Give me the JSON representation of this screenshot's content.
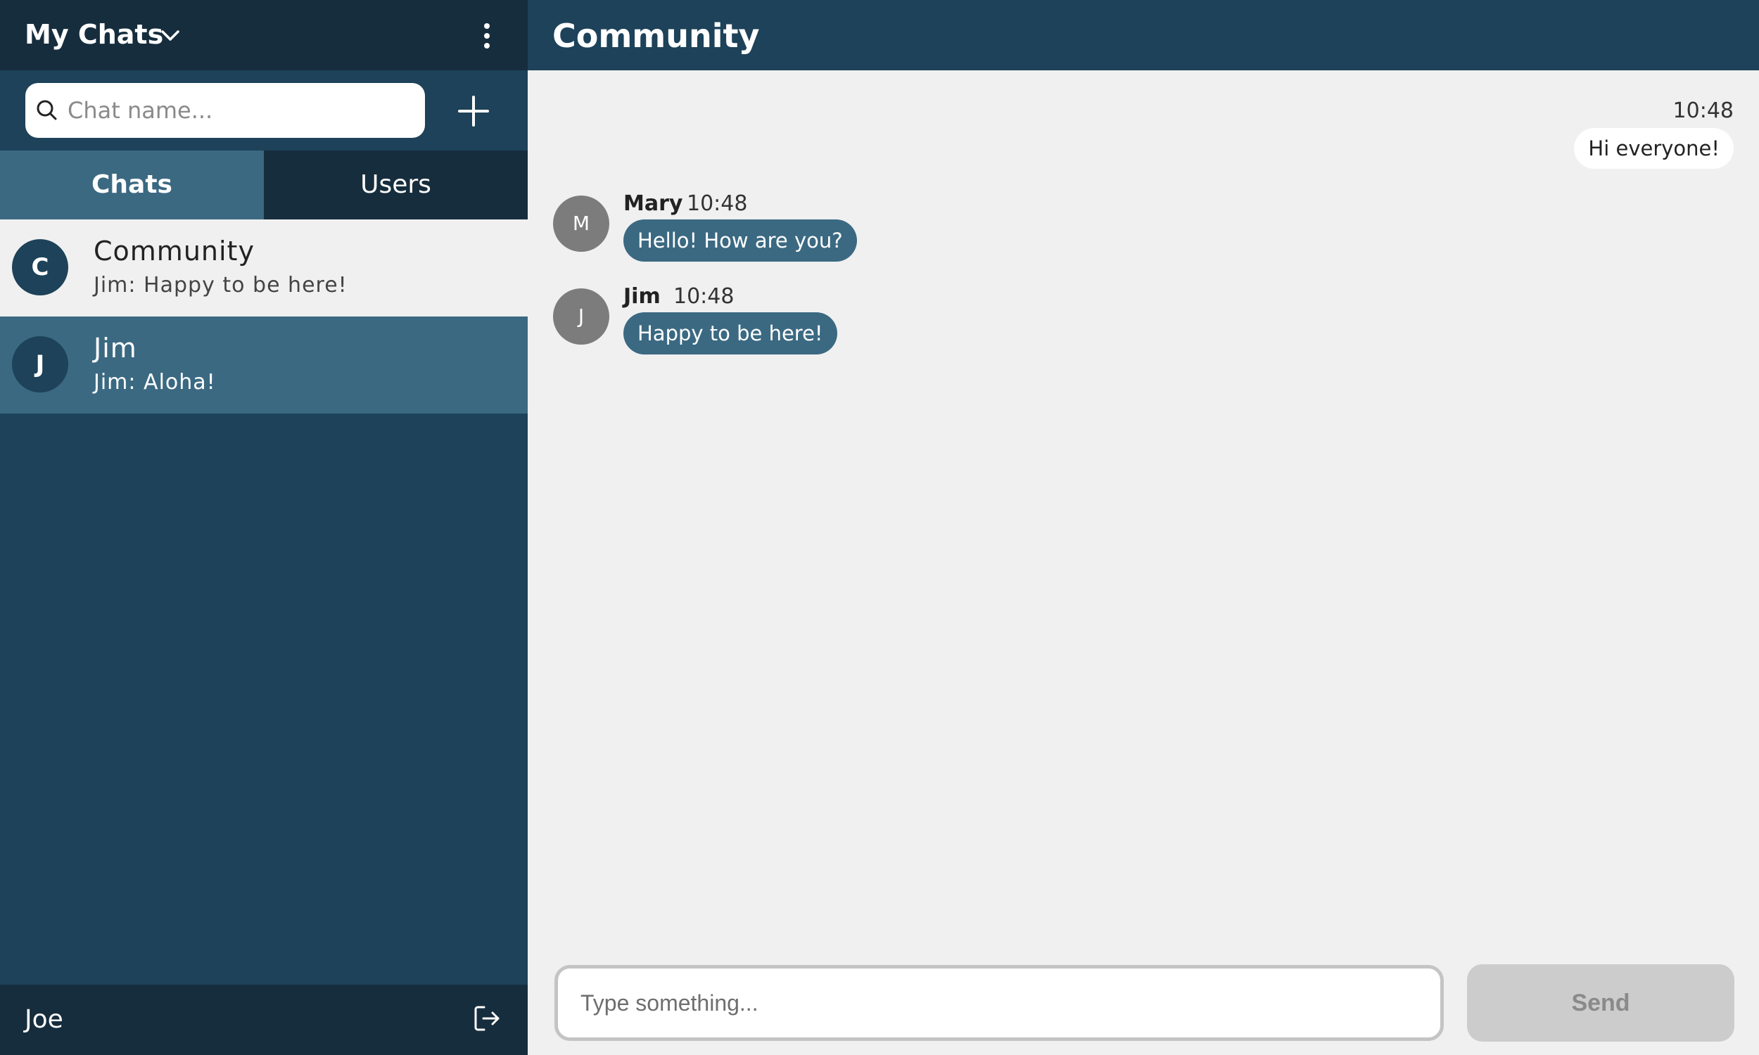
{
  "sidebar": {
    "title": "My Chats",
    "search": {
      "placeholder": "Chat name...",
      "value": ""
    },
    "tabs": [
      {
        "label": "Chats",
        "active": true
      },
      {
        "label": "Users",
        "active": false
      }
    ],
    "chats": [
      {
        "avatar_letter": "C",
        "name": "Community",
        "preview": "Jim: Happy to be here!",
        "selected": false
      },
      {
        "avatar_letter": "J",
        "name": "Jim",
        "preview": "Jim: Aloha!",
        "selected": true
      }
    ],
    "footer": {
      "username": "Joe"
    },
    "icons": {
      "dropdown": "chevron-down-icon",
      "menu": "kebab-menu-icon",
      "search": "search-icon",
      "new_chat": "plus-icon",
      "logout": "logout-icon"
    }
  },
  "main": {
    "title": "Community",
    "own_message": {
      "time": "10:48",
      "text": "Hi everyone!"
    },
    "messages": [
      {
        "avatar_letter": "M",
        "sender": "Mary",
        "time": "10:48",
        "text": "Hello! How are you?"
      },
      {
        "avatar_letter": "J",
        "sender": "Jim",
        "time": "10:48",
        "text": "Happy to be here!"
      }
    ],
    "composer": {
      "placeholder": "Type something...",
      "value": "",
      "send_label": "Send",
      "send_enabled": false
    }
  },
  "colors": {
    "sidebar_bg": "#1d4259",
    "header_dark": "#162d3d",
    "accent": "#3b6982",
    "main_bg": "#f0f0f0",
    "avatar_gray": "#7c7c7c",
    "send_disabled": "#cccccc"
  }
}
